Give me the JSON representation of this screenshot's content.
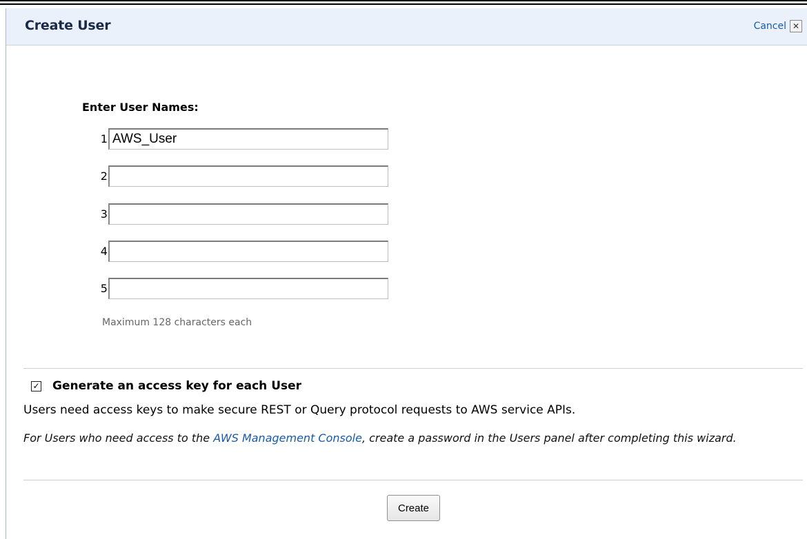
{
  "dialog": {
    "title": "Create User",
    "cancel_label": "Cancel",
    "close_glyph": "✕"
  },
  "form": {
    "section_label": "Enter User Names:",
    "rows": [
      {
        "num": "1.",
        "value": "AWS_User"
      },
      {
        "num": "2.",
        "value": ""
      },
      {
        "num": "3.",
        "value": ""
      },
      {
        "num": "4.",
        "value": ""
      },
      {
        "num": "5.",
        "value": ""
      }
    ],
    "hint": "Maximum 128 characters each"
  },
  "access_key": {
    "checked": true,
    "check_glyph": "✓",
    "label": "Generate an access key for each User",
    "description": "Users need access keys to make secure REST or Query protocol requests to AWS service APIs.",
    "note_prefix": "For Users who need access to the ",
    "note_link": "AWS Management Console",
    "note_suffix": ", create a password in the Users panel after completing this wizard."
  },
  "actions": {
    "create_label": "Create"
  }
}
